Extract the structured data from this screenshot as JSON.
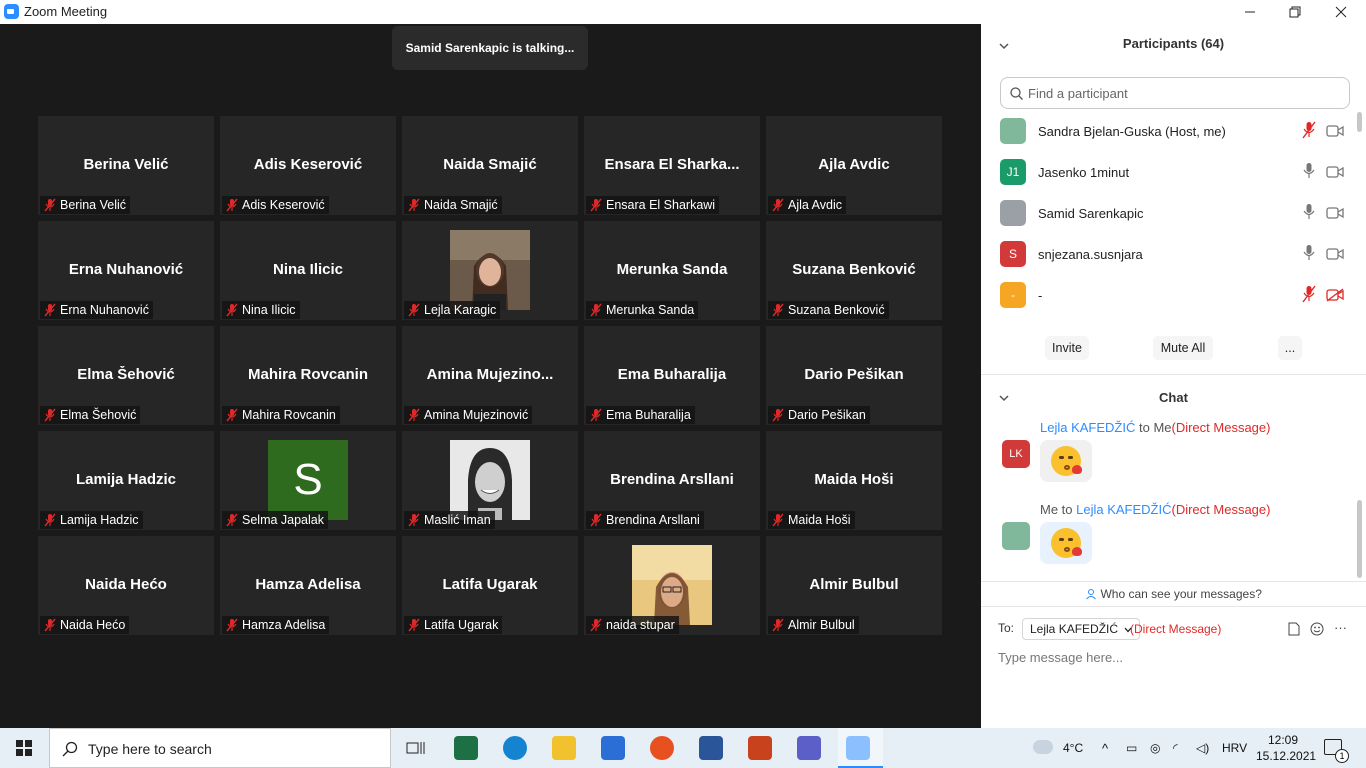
{
  "window": {
    "title": "Zoom Meeting",
    "minimize_icon": "minimize-icon",
    "maximize_icon": "restore-icon",
    "close_icon": "close-icon"
  },
  "meeting": {
    "talking_banner": "Samid Sarenkapic is talking...",
    "tiles": [
      {
        "display": "Berina Velić",
        "label": "Berina Velić",
        "video": false
      },
      {
        "display": "Adis Keserović",
        "label": "Adis Keserović",
        "video": false
      },
      {
        "display": "Naida Smajić",
        "label": "Naida Smajić",
        "video": false
      },
      {
        "display": "Ensara  El  Sharka...",
        "label": "Ensara El Sharkawi",
        "video": false
      },
      {
        "display": "Ajla Avdic",
        "label": "Ajla Avdic",
        "video": false
      },
      {
        "display": "Erna Nuhanović",
        "label": "Erna Nuhanović",
        "video": false
      },
      {
        "display": "Nina Ilicic",
        "label": "Nina Ilicic",
        "video": false
      },
      {
        "display": "",
        "label": "Lejla Karagic",
        "video": true,
        "photo": "woman-portrait"
      },
      {
        "display": "Merunka Sanda",
        "label": "Merunka Sanda",
        "video": false
      },
      {
        "display": "Suzana Benković",
        "label": "Suzana Benković",
        "video": false
      },
      {
        "display": "Elma Šehović",
        "label": "Elma Šehović",
        "video": false
      },
      {
        "display": "Mahira Rovcanin",
        "label": "Mahira Rovcanin",
        "video": false
      },
      {
        "display": "Amina  Mujezino...",
        "label": "Amina Mujezinović",
        "video": false
      },
      {
        "display": "Ema Buharalija",
        "label": "Ema Buharalija",
        "video": false
      },
      {
        "display": "Dario Pešikan",
        "label": "Dario Pešikan",
        "video": false
      },
      {
        "display": "Lamija Hadzic",
        "label": "Lamija Hadzic",
        "video": false
      },
      {
        "display": "",
        "label": "Selma Japalak",
        "video": true,
        "avatar_letter": "S"
      },
      {
        "display": "",
        "label": "Maslić Iman",
        "video": true,
        "photo": "bw-portrait"
      },
      {
        "display": "Brendina Arsllani",
        "label": "Brendina Arsllani",
        "video": false
      },
      {
        "display": "Maida Hoši",
        "label": "Maida Hoši",
        "video": false
      },
      {
        "display": "Naida Hećo",
        "label": "Naida Hećo",
        "video": false
      },
      {
        "display": "Hamza Adelisa",
        "label": "Hamza Adelisa",
        "video": false
      },
      {
        "display": "Latifa Ugarak",
        "label": "Latifa Ugarak",
        "video": false
      },
      {
        "display": "",
        "label": "naida stupar",
        "video": true,
        "photo": "glasses-portrait"
      },
      {
        "display": "Almir Bulbul",
        "label": "Almir Bulbul",
        "video": false
      }
    ]
  },
  "participants": {
    "header": "Participants (64)",
    "search_placeholder": "Find a participant",
    "list": [
      {
        "name": "Sandra Bjelan-Guska (Host, me)",
        "avatar": "",
        "avatar_color": "#7fb89a",
        "mic": "muted",
        "cam": "on"
      },
      {
        "name": "Jasenko 1minut",
        "avatar": "J1",
        "avatar_color": "#1c9b6a",
        "mic": "on",
        "cam": "on"
      },
      {
        "name": "Samid Sarenkapic",
        "avatar": "",
        "avatar_color": "#9aa0a6",
        "mic": "on",
        "cam": "on"
      },
      {
        "name": "snjezana.susnjara",
        "avatar": "S",
        "avatar_color": "#d23a3a",
        "mic": "on",
        "cam": "on"
      },
      {
        "name": "-",
        "avatar": "-",
        "avatar_color": "#f5a623",
        "mic": "muted",
        "cam": "off"
      }
    ],
    "invite_label": "Invite",
    "mute_all_label": "Mute All",
    "more_label": "..."
  },
  "chat": {
    "header": "Chat",
    "messages": [
      {
        "from": "Lejla KAFEDŽIĆ",
        "to": " to Me",
        "tag": "(Direct Message)",
        "avatar": "LK"
      },
      {
        "from": "Me to ",
        "to": "Lejla KAFEDŽIĆ",
        "tag": "(Direct Message)",
        "avatar": ""
      }
    ],
    "who_can_see": "Who can see your messages?",
    "to_label": "To:",
    "to_recipient": "Lejla KAFEDŽIĆ",
    "to_tag": "(Direct Message)",
    "input_placeholder": "Type message here..."
  },
  "taskbar": {
    "search_placeholder": "Type here to search",
    "weather": "4°C",
    "lang": "HRV",
    "time": "12:09",
    "date": "15.12.2021",
    "notifications": "1"
  }
}
